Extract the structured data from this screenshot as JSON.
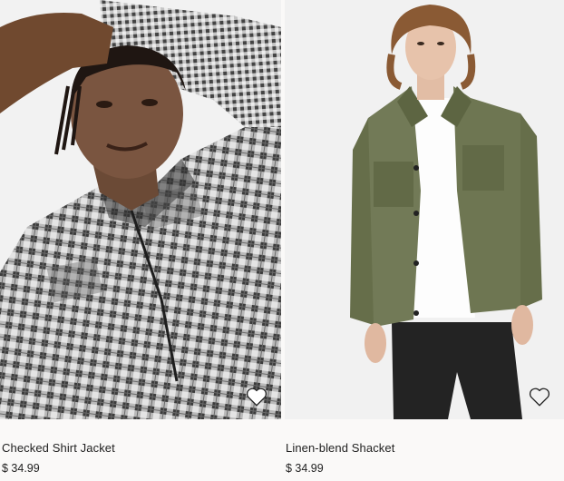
{
  "products": [
    {
      "name": "Checked Shirt Jacket",
      "price": "$ 34.99",
      "favorite_icon": "heart-outline-icon",
      "image_subject": "man-in-checked-shirt-jacket"
    },
    {
      "name": "Linen-blend Shacket",
      "price": "$ 34.99",
      "favorite_icon": "heart-outline-icon",
      "image_subject": "man-in-olive-shacket"
    }
  ],
  "colors": {
    "page_background": "#faf9f8",
    "text": "#222222",
    "photo_background": "#f3f3f3"
  }
}
